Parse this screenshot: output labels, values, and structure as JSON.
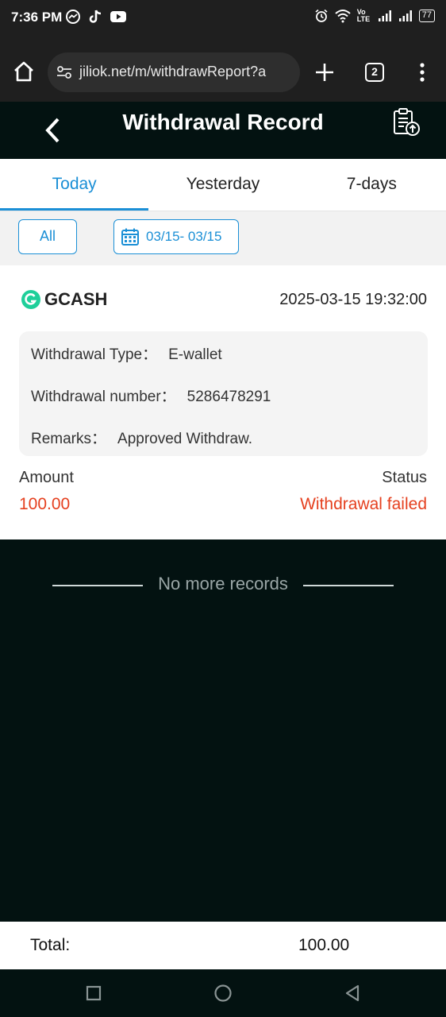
{
  "status_bar": {
    "time": "7:36 PM",
    "left_icons": [
      "messenger-icon",
      "tiktok-icon",
      "youtube-icon"
    ],
    "right_icons": [
      "alarm-icon",
      "wifi-icon",
      "volte-icon",
      "signal-icon",
      "signal-icon"
    ],
    "volte_label": "Vo LTE",
    "battery": "77"
  },
  "browser": {
    "url": "jiliok.net/m/withdrawReport?a",
    "tab_count": "2"
  },
  "header": {
    "title": "Withdrawal Record"
  },
  "tabs": [
    {
      "label": "Today",
      "active": true
    },
    {
      "label": "Yesterday",
      "active": false
    },
    {
      "label": "7-days",
      "active": false
    }
  ],
  "filter": {
    "all_label": "All",
    "date_range": "03/15- 03/15"
  },
  "record": {
    "method": "GCASH",
    "datetime": "2025-03-15 19:32:00",
    "type_label": "Withdrawal Type：",
    "type_value": "E-wallet",
    "number_label": "Withdrawal number：",
    "number_value": "5286478291",
    "remarks_label": "Remarks：",
    "remarks_value": "Approved Withdraw.",
    "amount_label": "Amount",
    "amount_value": "100.00",
    "status_label": "Status",
    "status_value": "Withdrawal failed"
  },
  "list_end": "No more records",
  "total": {
    "label": "Total:",
    "value": "100.00"
  },
  "colors": {
    "accent": "#1a8fd6",
    "error": "#e5401f",
    "dark_bg": "#031211",
    "gcash": "#1fcf9a"
  }
}
